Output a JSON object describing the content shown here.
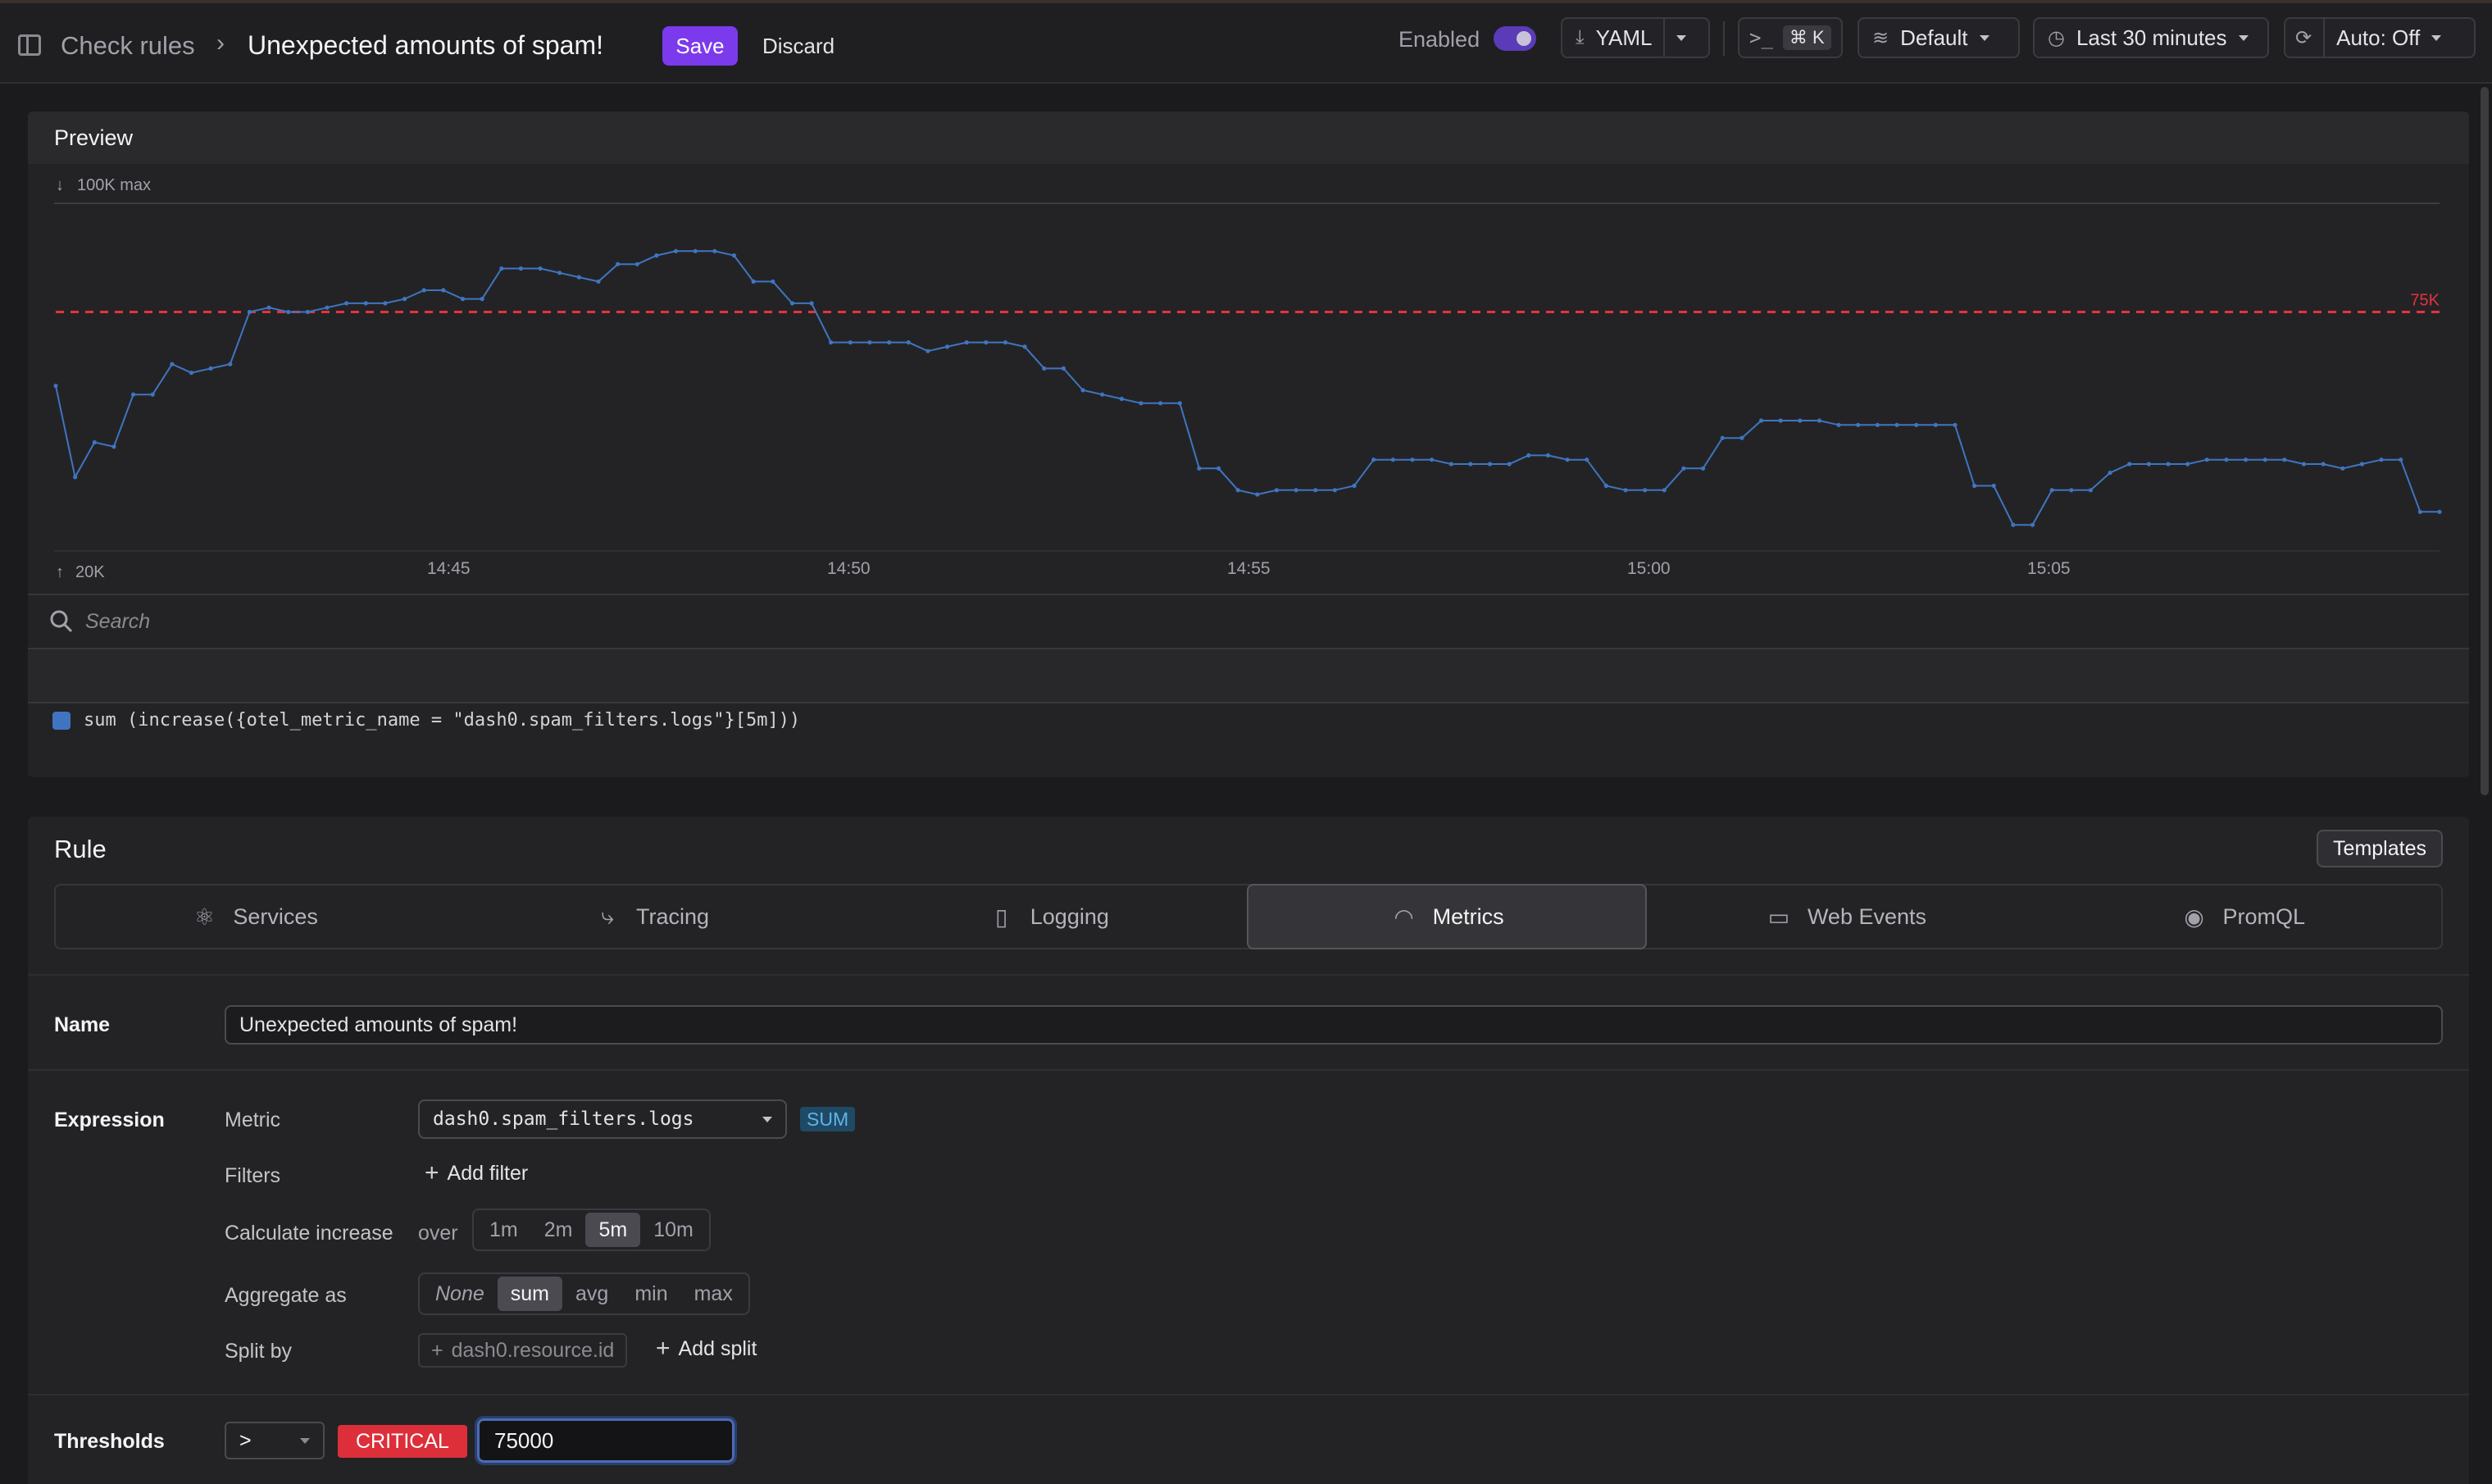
{
  "header": {
    "breadcrumb": "Check rules",
    "separator": "›",
    "title": "Unexpected amounts of spam!",
    "save_label": "Save",
    "discard_label": "Discard",
    "enabled_label": "Enabled",
    "yaml_label": "YAML",
    "command_shortcut": "⌘ K",
    "dataset_label": "Default",
    "time_range_label": "Last 30 minutes",
    "refresh_label": "Auto: Off"
  },
  "preview": {
    "title": "Preview",
    "max_label": "100K max",
    "min_label": "20K",
    "threshold_label": "75K",
    "search_placeholder": "Search",
    "legend_query": "sum (increase({otel_metric_name = \"dash0.spam_filters.logs\"}[5m]))",
    "series_color": "#3f75c0",
    "threshold_color": "#e5323e"
  },
  "chart_data": {
    "type": "line",
    "title": "",
    "xlabel": "",
    "ylabel": "",
    "ylim": [
      20000,
      100000
    ],
    "x_ticks": [
      "14:45",
      "14:50",
      "14:55",
      "15:00",
      "15:05"
    ],
    "threshold": 75000,
    "series": [
      {
        "values": [
          58000,
          37000,
          45000,
          44000,
          56000,
          56000,
          63000,
          61000,
          62000,
          63000,
          75000,
          76000,
          75000,
          75000,
          76000,
          77000,
          77000,
          77000,
          78000,
          80000,
          80000,
          78000,
          78000,
          85000,
          85000,
          85000,
          84000,
          83000,
          82000,
          86000,
          86000,
          88000,
          89000,
          89000,
          89000,
          88000,
          82000,
          82000,
          77000,
          77000,
          68000,
          68000,
          68000,
          68000,
          68000,
          66000,
          67000,
          68000,
          68000,
          68000,
          67000,
          62000,
          62000,
          57000,
          56000,
          55000,
          54000,
          54000,
          54000,
          39000,
          39000,
          34000,
          33000,
          34000,
          34000,
          34000,
          34000,
          35000,
          41000,
          41000,
          41000,
          41000,
          40000,
          40000,
          40000,
          40000,
          42000,
          42000,
          41000,
          41000,
          35000,
          34000,
          34000,
          34000,
          39000,
          39000,
          46000,
          46000,
          50000,
          50000,
          50000,
          50000,
          49000,
          49000,
          49000,
          49000,
          49000,
          49000,
          49000,
          35000,
          35000,
          26000,
          26000,
          34000,
          34000,
          34000,
          38000,
          40000,
          40000,
          40000,
          40000,
          41000,
          41000,
          41000,
          41000,
          41000,
          40000,
          40000,
          39000,
          40000,
          41000,
          41000,
          29000,
          29000
        ]
      }
    ]
  },
  "rule": {
    "title": "Rule",
    "templates_label": "Templates",
    "tabs": [
      {
        "label": "Services",
        "icon": "services-icon"
      },
      {
        "label": "Tracing",
        "icon": "tracing-icon"
      },
      {
        "label": "Logging",
        "icon": "logging-icon"
      },
      {
        "label": "Metrics",
        "icon": "metrics-icon"
      },
      {
        "label": "Web Events",
        "icon": "web-events-icon"
      },
      {
        "label": "PromQL",
        "icon": "promql-icon"
      }
    ],
    "active_tab": "Metrics",
    "name_label": "Name",
    "name_value": "Unexpected amounts of spam!",
    "expression_label": "Expression",
    "metric_label": "Metric",
    "metric_value": "dash0.spam_filters.logs",
    "metric_type_badge": "SUM",
    "filters_label": "Filters",
    "add_filter_label": "Add filter",
    "calc_increase_label": "Calculate increase",
    "over_label": "over",
    "intervals": [
      "1m",
      "2m",
      "5m",
      "10m"
    ],
    "selected_interval": "5m",
    "aggregate_label": "Aggregate as",
    "aggregations": [
      "None",
      "sum",
      "avg",
      "min",
      "max"
    ],
    "selected_aggregation": "sum",
    "split_by_label": "Split by",
    "split_chip": "dash0.resource.id",
    "add_split_label": "Add split",
    "thresholds_label": "Thresholds",
    "operator_value": ">",
    "severity_label": "CRITICAL",
    "threshold_value": "75000"
  }
}
